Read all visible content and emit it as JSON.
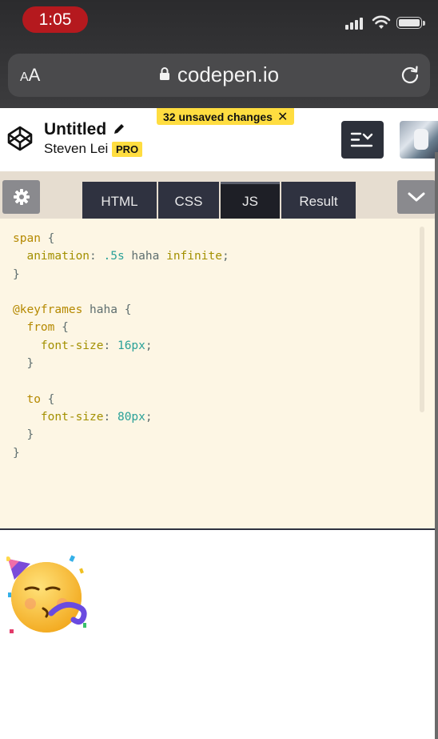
{
  "status_bar": {
    "time": "1:05"
  },
  "browser": {
    "aa_large": "A",
    "aa_small": "A",
    "url": "codepen.io"
  },
  "header": {
    "title": "Untitled",
    "author": "Steven Lei",
    "badge": "PRO",
    "unsaved_changes": "32 unsaved changes",
    "unsaved_close": "✕"
  },
  "tabs": [
    {
      "label": "HTML",
      "active": false
    },
    {
      "label": "CSS",
      "active": false
    },
    {
      "label": "JS",
      "active": true
    },
    {
      "label": "Result",
      "active": false
    }
  ],
  "code": {
    "lines": [
      [
        {
          "t": "span",
          "c": "sel"
        },
        {
          "t": " {",
          "c": "plain"
        }
      ],
      [
        {
          "t": "  animation",
          "c": "prop"
        },
        {
          "t": ": ",
          "c": "plain"
        },
        {
          "t": ".5s",
          "c": "num"
        },
        {
          "t": " haha ",
          "c": "plain"
        },
        {
          "t": "infinite",
          "c": "prop"
        },
        {
          "t": ";",
          "c": "plain"
        }
      ],
      [
        {
          "t": "}",
          "c": "plain"
        }
      ],
      [],
      [
        {
          "t": "@keyframes",
          "c": "at"
        },
        {
          "t": " haha {",
          "c": "plain"
        }
      ],
      [
        {
          "t": "  from",
          "c": "sel"
        },
        {
          "t": " {",
          "c": "plain"
        }
      ],
      [
        {
          "t": "    font-size",
          "c": "prop"
        },
        {
          "t": ": ",
          "c": "plain"
        },
        {
          "t": "16px",
          "c": "num"
        },
        {
          "t": ";",
          "c": "plain"
        }
      ],
      [
        {
          "t": "  }",
          "c": "plain"
        }
      ],
      [],
      [
        {
          "t": "  to",
          "c": "sel"
        },
        {
          "t": " {",
          "c": "plain"
        }
      ],
      [
        {
          "t": "    font-size",
          "c": "prop"
        },
        {
          "t": ": ",
          "c": "plain"
        },
        {
          "t": "80px",
          "c": "num"
        },
        {
          "t": ";",
          "c": "plain"
        }
      ],
      [
        {
          "t": "  }",
          "c": "plain"
        }
      ],
      [
        {
          "t": "}",
          "c": "plain"
        }
      ]
    ]
  },
  "result": {
    "emoji": "party-face-emoji"
  },
  "colors": {
    "accent_yellow": "#ffdd40",
    "editor_bg": "#fdf6e4",
    "tab_bg": "#2f3240"
  }
}
